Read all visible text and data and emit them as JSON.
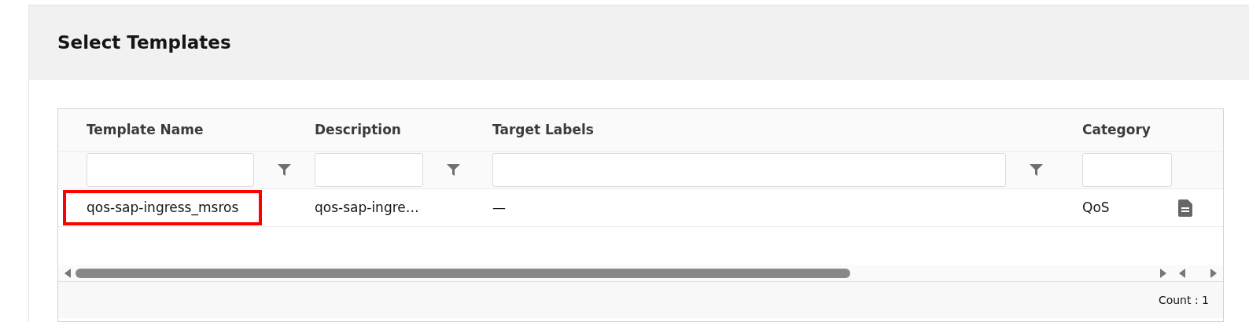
{
  "header": {
    "title": "Select Templates"
  },
  "table": {
    "columns": [
      {
        "label": "Template Name",
        "filterable": true
      },
      {
        "label": "Description",
        "filterable": true
      },
      {
        "label": "Target Labels",
        "filterable": true
      },
      {
        "label": "Category"
      }
    ],
    "rows": [
      {
        "cells": [
          "qos-sap-ingress_msros",
          "qos-sap-ingre…",
          "—",
          "QoS"
        ],
        "highlighted": true
      }
    ]
  },
  "footer": {
    "count": "Count : 1"
  }
}
